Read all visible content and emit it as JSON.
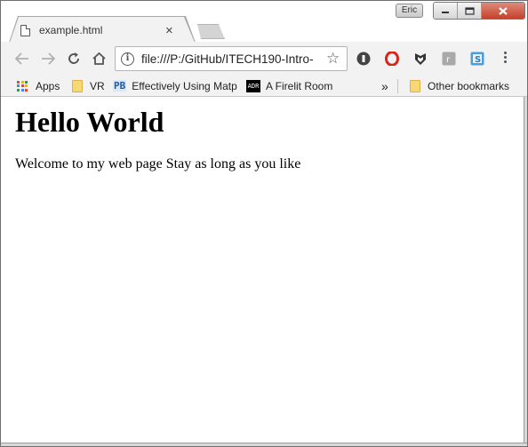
{
  "window": {
    "user_name": "Eric",
    "controls": {
      "minimize": "▭",
      "maximize": "▢",
      "close": "✕"
    }
  },
  "tabs": [
    {
      "title": "example.html",
      "close_label": "×",
      "active": true
    }
  ],
  "toolbar": {
    "back_icon": "arrow-left",
    "forward_icon": "arrow-right",
    "reload_icon": "reload",
    "home_icon": "home",
    "url": "file:///P:/GitHub/ITECH190-Intro-",
    "star_label": "☆",
    "extensions": [
      {
        "name": "instapaper-extension",
        "color": "#444444"
      },
      {
        "name": "opera-extension",
        "color": "#d9241a"
      },
      {
        "name": "shield-extension",
        "color": "#333333"
      },
      {
        "name": "gray-extension",
        "color": "#a9a9a9"
      },
      {
        "name": "s-extension",
        "color": "#4a9fd8"
      }
    ]
  },
  "bookmarks": {
    "apps": "Apps",
    "items": [
      {
        "label": "VR",
        "icon": "folder"
      },
      {
        "label": "Effectively Using Matp",
        "icon": "PB"
      },
      {
        "label": "A Firelit Room",
        "icon": "ADR"
      }
    ],
    "overflow": "»",
    "other": "Other bookmarks"
  },
  "page": {
    "heading": "Hello World",
    "paragraph": "Welcome to my web page Stay as long as you like"
  }
}
